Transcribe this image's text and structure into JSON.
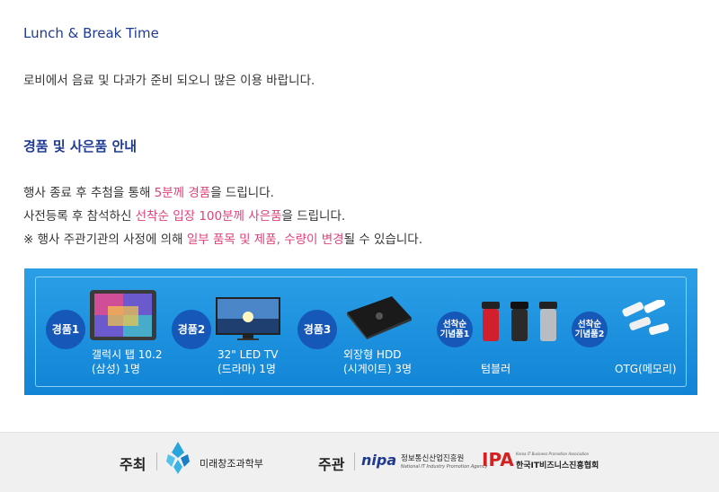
{
  "section1": {
    "title": "Lunch & Break Time",
    "body": "로비에서 음료 및 다과가 준비 되오니 많은 이용 바랍니다."
  },
  "section2": {
    "title": "경품 및 사은품 안내",
    "line1": {
      "pre": "행사 종료 후 추첨을 통해 ",
      "hl": "5분께 경품",
      "post": "을 드립니다."
    },
    "line2": {
      "pre": "사전등록 후 참석하신 ",
      "hl": "선착순 입장 100분께 사은품",
      "post": "을 드립니다."
    },
    "line3": {
      "pre": "※ 행사 주관기관의 사정에 의해 ",
      "hl": "일부 품목 및 제품, 수량이 변경",
      "post": "될 수 있습니다."
    }
  },
  "prizes": [
    {
      "badge": "경품1",
      "line1": "갤럭시 탭 10.2",
      "line2": "(삼성) 1명",
      "icon": "tablet-icon"
    },
    {
      "badge": "경품2",
      "line1": "32\" LED TV",
      "line2": "(드라마) 1명",
      "icon": "tv-icon"
    },
    {
      "badge": "경품3",
      "line1": "외장형 HDD",
      "line2": "(시게이트) 3명",
      "icon": "hdd-icon"
    }
  ],
  "gifts": [
    {
      "badge_line1": "선착순",
      "badge_line2": "기념품1",
      "label": "텀블러",
      "icon": "tumbler-icon"
    },
    {
      "badge_line1": "선착순",
      "badge_line2": "기념품2",
      "label": "OTG(메모리)",
      "icon": "usb-memory-icon"
    }
  ],
  "footer": {
    "host_label": "주최",
    "host_name": "미래창조과학부",
    "organizer_label": "주관",
    "nipa_logo": "nipa",
    "nipa_name": "정보통신산업진흥원",
    "nipa_eng": "National IT Industry Promotion Agency",
    "ipa_logo": "IPA",
    "ipa_eng": "Korea IT Business Promotion Association",
    "ipa_name": "한국IT비즈니스진흥협회"
  },
  "colors": {
    "title_blue": "#1f3a93",
    "highlight_pink": "#e0407a",
    "banner_blue": "#1a8fe0",
    "badge_navy": "#1558b8"
  }
}
